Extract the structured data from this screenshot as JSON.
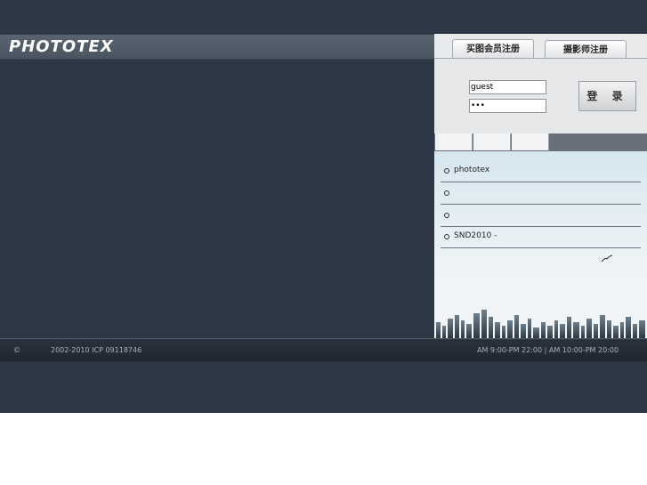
{
  "brand": {
    "logo_text": "PHOTOTEX"
  },
  "tabs": [
    {
      "label": "买图会员注册"
    },
    {
      "label": "摄影师注册"
    }
  ],
  "login": {
    "username_value": "guest",
    "password_value": "•••",
    "button_label": "登 录"
  },
  "news": {
    "items": [
      {
        "label": "phototex"
      },
      {
        "label": ""
      },
      {
        "label": ""
      },
      {
        "label": "SND2010   -"
      }
    ]
  },
  "footer": {
    "copyright_symbol": "©",
    "copyright_text": "2002-2010  ICP 09118746",
    "hours": "AM 9:00-PM 22:00 |   AM 10:00-PM 20:00"
  }
}
